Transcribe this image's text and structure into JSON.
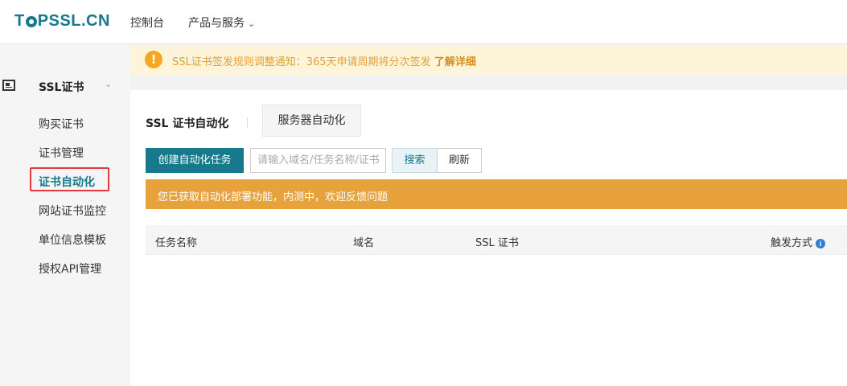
{
  "header": {
    "logo_prefix": "T",
    "logo_suffix": "PSSL.CN",
    "nav": {
      "console": "控制台",
      "products": "产品与服务"
    }
  },
  "sidebar": {
    "title": "SSL证书",
    "items": [
      {
        "label": "购买证书"
      },
      {
        "label": "证书管理"
      },
      {
        "label": "证书自动化",
        "active": true
      },
      {
        "label": "网站证书监控"
      },
      {
        "label": "单位信息模板"
      },
      {
        "label": "授权API管理"
      }
    ]
  },
  "notice": {
    "text": "SSL证书签发规则调整通知：365天申请周期将分次签发",
    "link": "了解详细"
  },
  "tabs": {
    "ssl": "SSL 证书自动化",
    "server": "服务器自动化"
  },
  "toolbar": {
    "create": "创建自动化任务",
    "search_placeholder": "请输入域名/任务名称/证书",
    "search": "搜索",
    "refresh": "刷新"
  },
  "banner": {
    "text": "您已获取自动化部署功能，内测中，欢迎反馈问题"
  },
  "table": {
    "columns": [
      "任务名称",
      "域名",
      "SSL 证书",
      "触发方式"
    ]
  },
  "colors": {
    "brand": "#177a8c",
    "banner": "#e8a23c",
    "notice_bg": "#fdf4d9",
    "highlight_border": "#e03a3a"
  }
}
